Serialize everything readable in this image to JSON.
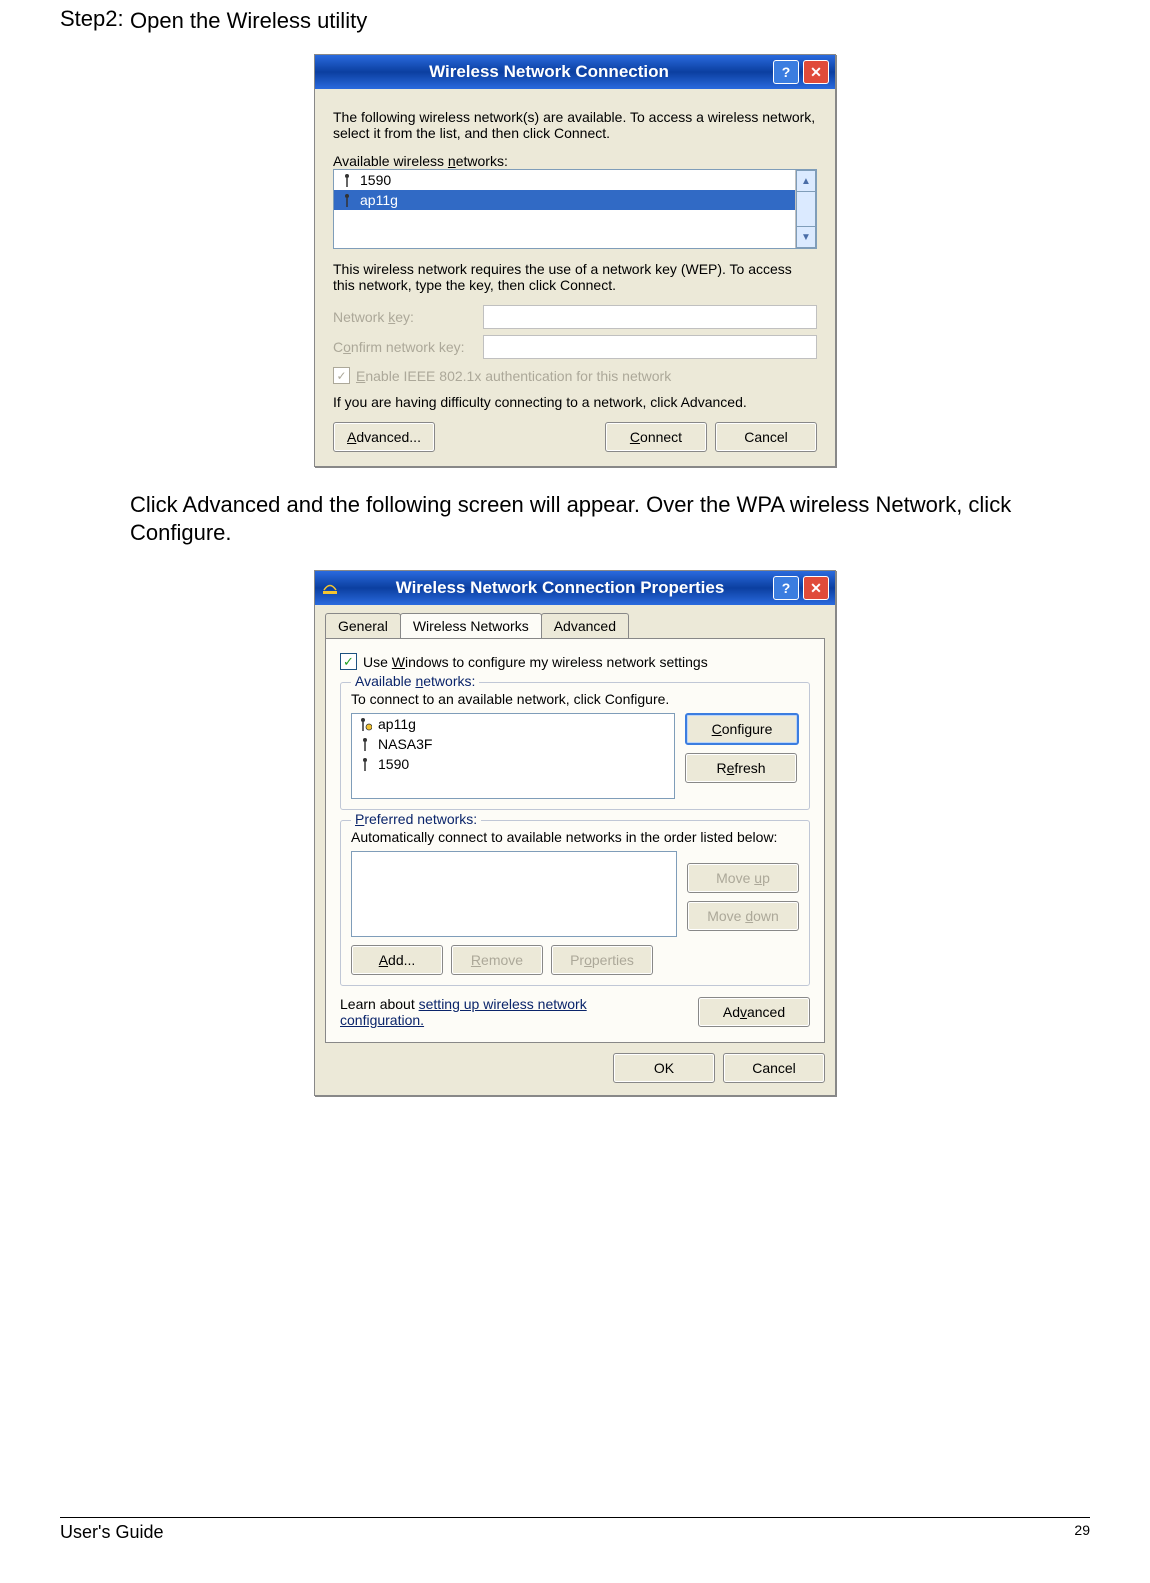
{
  "step_label": "Step2:",
  "step_text": "Open the Wireless utility",
  "paragraph": "Click Advanced and the following screen will appear. Over the WPA wireless Network, click Configure.",
  "dialog1": {
    "title": "Wireless Network Connection",
    "intro": "The following wireless network(s) are available. To access a wireless network, select it from the list, and then click Connect.",
    "available_label": "Available wireless networks:",
    "networks": [
      "1590",
      "ap11g"
    ],
    "selected": "ap11g",
    "wep_note": "This wireless network requires the use of a network key (WEP). To access this network, type the key, then click Connect.",
    "network_key_label": "Network key:",
    "confirm_key_label": "Confirm network key:",
    "enable_8021x_label": "Enable IEEE 802.1x authentication for this network",
    "difficulty_text": "If you are having difficulty connecting to a network, click Advanced.",
    "advanced_btn": "Advanced...",
    "connect_btn": "Connect",
    "cancel_btn": "Cancel"
  },
  "dialog2": {
    "title": "Wireless Network Connection Properties",
    "tabs": [
      "General",
      "Wireless Networks",
      "Advanced"
    ],
    "active_tab": "Wireless Networks",
    "use_windows_label": "Use Windows to configure my wireless network settings",
    "available_group_label": "Available networks:",
    "available_desc": "To connect to an available network, click Configure.",
    "available_networks": [
      "ap11g",
      "NASA3F",
      "1590"
    ],
    "configure_btn": "Configure",
    "refresh_btn": "Refresh",
    "preferred_group_label": "Preferred networks:",
    "preferred_desc": "Automatically connect to available networks in the order listed below:",
    "moveup_btn": "Move up",
    "movedown_btn": "Move down",
    "add_btn": "Add...",
    "remove_btn": "Remove",
    "properties_btn": "Properties",
    "learn_text": "Learn about ",
    "learn_link": "setting up wireless network configuration.",
    "advanced_btn": "Advanced",
    "ok_btn": "OK",
    "cancel_btn": "Cancel"
  },
  "footer": {
    "guide": "User's Guide",
    "page": "29"
  }
}
